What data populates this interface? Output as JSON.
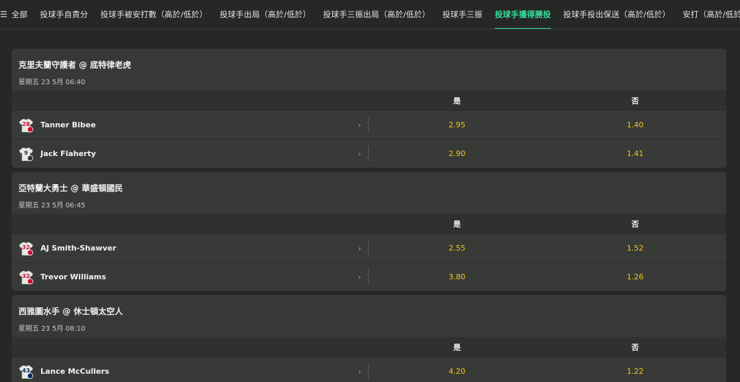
{
  "tabs": [
    {
      "label": "全部",
      "icon": "menu-icon"
    },
    {
      "label": "投球手自責分"
    },
    {
      "label": "投球手被安打數（高於/低於）"
    },
    {
      "label": "投球手出局（高於/低於）"
    },
    {
      "label": "投球手三振出局（高於/低於）"
    },
    {
      "label": "投球手三振"
    },
    {
      "label": "投球手獲得勝投",
      "active": true
    },
    {
      "label": "投球手投出保送（高於/低於）"
    },
    {
      "label": "安打（高於/低於）"
    }
  ],
  "menu_glyph": "☰",
  "accent": "#34e0a1",
  "odds_color": "#f5c518",
  "matches": [
    {
      "title": "克里夫蘭守護者 @ 底特律老虎",
      "time": "星期五 23 5月 06:40",
      "yes": "是",
      "no": "否",
      "players": [
        {
          "name": "Tanner Bibee",
          "number": "28",
          "num_color": "#c8102e",
          "yes": "2.95",
          "no": "1.40"
        },
        {
          "name": "Jack Flaherty",
          "number": "9",
          "num_color": "#333333",
          "yes": "2.90",
          "no": "1.41"
        }
      ]
    },
    {
      "title": "亞特蘭大勇士 @ 華盛頓國民",
      "time": "星期五 23 5月 06:45",
      "yes": "是",
      "no": "否",
      "players": [
        {
          "name": "AJ Smith-Shawver",
          "number": "32",
          "num_color": "#c8102e",
          "yes": "2.55",
          "no": "1.52"
        },
        {
          "name": "Trevor Williams",
          "number": "32",
          "num_color": "#c8102e",
          "yes": "3.80",
          "no": "1.26"
        }
      ]
    },
    {
      "title": "西雅圖水手 @ 休士頓太空人",
      "time": "星期五 23 5月 08:10",
      "yes": "是",
      "no": "否",
      "players": [
        {
          "name": "Lance McCullers",
          "number": "43",
          "num_color": "#002d62",
          "yes": "4.20",
          "no": "1.22"
        }
      ]
    }
  ]
}
